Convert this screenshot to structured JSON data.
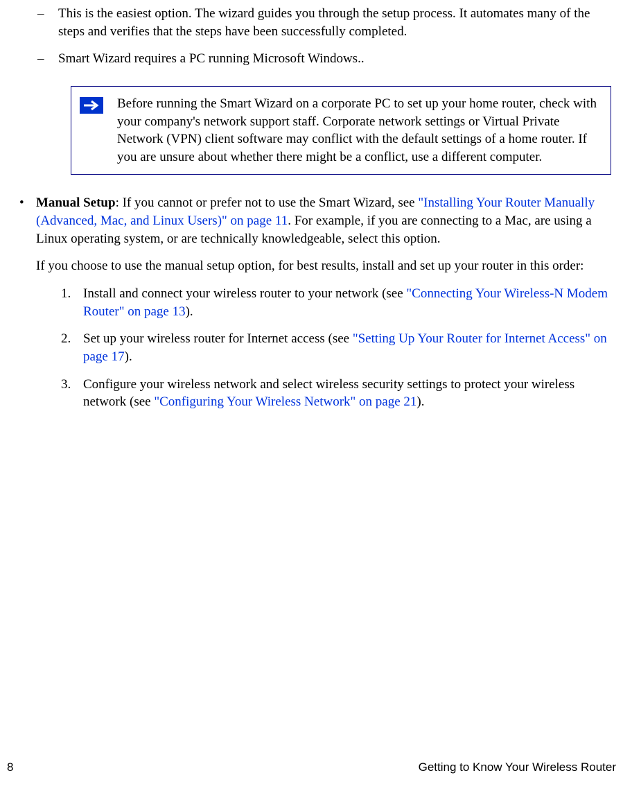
{
  "dashes": [
    "This is the easiest option. The wizard guides you through the setup process. It automates many of the steps and verifies that the steps have been successfully completed.",
    "Smart Wizard requires a PC running Microsoft Windows.."
  ],
  "note": "Before running the Smart Wizard on a corporate PC to set up your home router, check with your company's network support staff. Corporate network settings or Virtual Private Network (VPN) client software may conflict with the default settings of a home router. If you are unsure about whether there might be a conflict, use a different computer.",
  "manual": {
    "label": "Manual Setup",
    "pre": ": If you cannot or prefer not to use the Smart Wizard, see  ",
    "link": "\"Installing Your Router Manually (Advanced, Mac, and Linux Users)\" on page 11",
    "post": ". For example, if you are connecting to a Mac, are using a Linux operating system, or are technically knowledgeable, select this option."
  },
  "manual_para2": "If you choose to use the manual setup option, for best results, install and set up your router in this order:",
  "steps": [
    {
      "num": "1.",
      "pre": "Install and connect your wireless router to your network (see ",
      "link": "\"Connecting Your Wireless-N Modem Router\" on page 13",
      "post": ")."
    },
    {
      "num": "2.",
      "pre": "Set up your wireless router for Internet access (see ",
      "link": "\"Setting Up Your Router for Internet Access\" on page 17",
      "post": ")."
    },
    {
      "num": "3.",
      "pre": "Configure your wireless network and select wireless security settings to protect your wireless network (see ",
      "link": "\"Configuring Your Wireless Network\" on page 21",
      "post": ")."
    }
  ],
  "footer": {
    "page": "8",
    "title": "Getting to Know Your Wireless Router"
  }
}
